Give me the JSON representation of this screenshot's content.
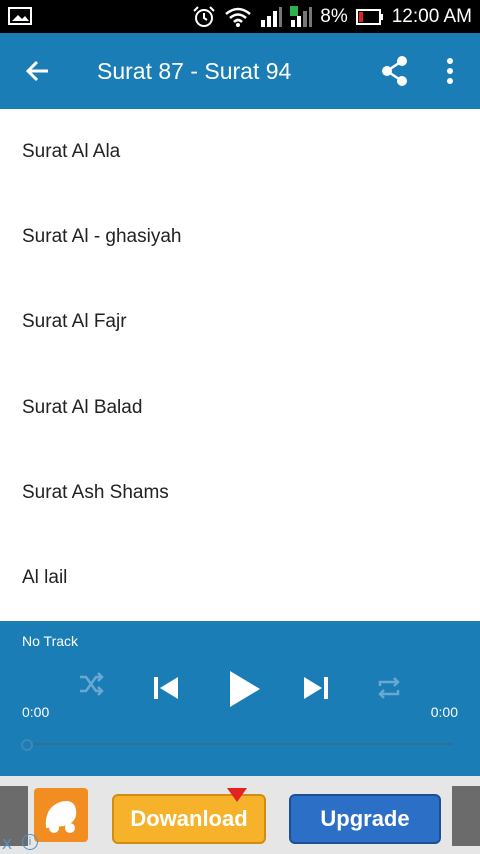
{
  "status_bar": {
    "battery": "8%",
    "time": "12:00 AM",
    "icons": [
      "image-icon",
      "alarm-icon",
      "wifi-icon",
      "signal-icon",
      "signal-2-icon",
      "battery-icon"
    ]
  },
  "toolbar": {
    "title": "Surat 87 - Surat 94",
    "icons": [
      "back-arrow-icon",
      "share-icon",
      "more-vert-icon"
    ]
  },
  "list": {
    "items": [
      {
        "label": "Surat Al Ala"
      },
      {
        "label": "Surat Al - ghasiyah"
      },
      {
        "label": "Surat Al Fajr"
      },
      {
        "label": "Surat Al Balad"
      },
      {
        "label": "Surat Ash Shams"
      },
      {
        "label": "Al lail"
      }
    ]
  },
  "player": {
    "track": "No Track",
    "time_left": "0:00",
    "time_right": "0:00",
    "progress": 0,
    "icons": [
      "shuffle-icon",
      "previous-icon",
      "play-icon",
      "next-icon",
      "repeat-icon"
    ]
  },
  "ad": {
    "download_label": "Dowanload",
    "upgrade_label": "Upgrade",
    "close_label": "X",
    "info_label": "i"
  },
  "colors": {
    "accent": "#1a7db5",
    "status_bar": "#000000",
    "text": "#222222"
  }
}
